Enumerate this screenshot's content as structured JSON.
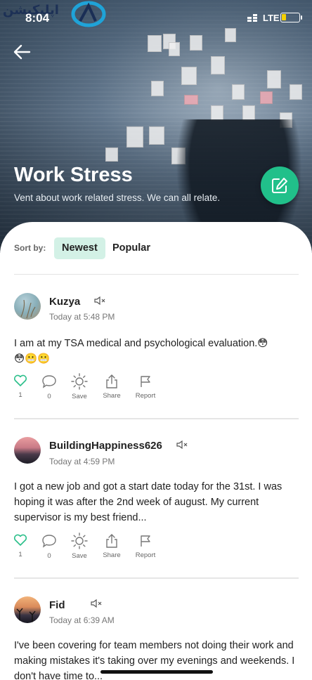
{
  "status_bar": {
    "time": "8:04",
    "network": "LTE",
    "logo_text": "اپلیکیشن",
    "battery_level": 0.25,
    "battery_color": "#f5d000"
  },
  "header": {
    "title": "Work Stress",
    "subtitle": "Vent about work related stress. We can all relate."
  },
  "sort": {
    "label": "Sort by:",
    "options": [
      "Newest",
      "Popular"
    ],
    "active": "Newest"
  },
  "posts": [
    {
      "username": "Kuzya",
      "timestamp": "Today at 5:48 PM",
      "body": "I am at my TSA medical and psychological evaluation.😳\n😳😬😬",
      "likes": "1",
      "comments": "0",
      "save_label": "Save",
      "share_label": "Share",
      "report_label": "Report"
    },
    {
      "username": "BuildingHappiness626",
      "timestamp": "Today at 4:59 PM",
      "body": "I got a new job and got a start date today for the 31st. I was hoping it was after the 2nd week of august. My current supervisor is my best friend...",
      "likes": "1",
      "comments": "0",
      "save_label": "Save",
      "share_label": "Share",
      "report_label": "Report"
    },
    {
      "username": "Fid",
      "timestamp": "Today at 6:39 AM",
      "body": "I've been covering for team members not doing their work and making mistakes it's taking over my evenings and weekends. I don't have time to..."
    }
  ],
  "colors": {
    "accent": "#21c08a",
    "tab_active_bg": "#d3f1e6",
    "like_icon": "#2bbf8a"
  },
  "icons": [
    "back-arrow-icon",
    "compose-icon",
    "mute-icon",
    "heart-icon",
    "comment-icon",
    "save-icon",
    "share-icon",
    "report-flag-icon",
    "signal-icon",
    "battery-icon"
  ]
}
